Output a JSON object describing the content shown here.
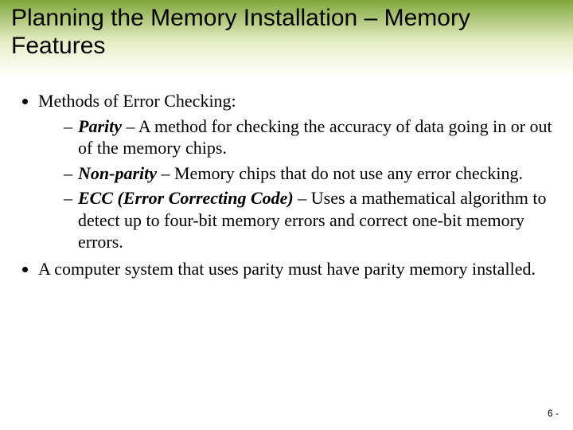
{
  "title": "Planning the Memory Installation – Memory Features",
  "bullets": {
    "b1": "Methods of Error Checking:",
    "sub": {
      "parity": {
        "term": "Parity",
        "desc": " – A method for checking the accuracy of data going in or out of the memory chips."
      },
      "nonparity": {
        "term": "Non-parity",
        "desc": " – Memory chips that do not use any error checking."
      },
      "ecc": {
        "term": "ECC (Error Correcting Code)",
        "desc": " – Uses a mathematical algorithm to detect up to four-bit memory errors and correct one-bit memory errors."
      }
    },
    "b2": "A computer system that uses parity must have parity memory installed."
  },
  "page_number": "6 -"
}
